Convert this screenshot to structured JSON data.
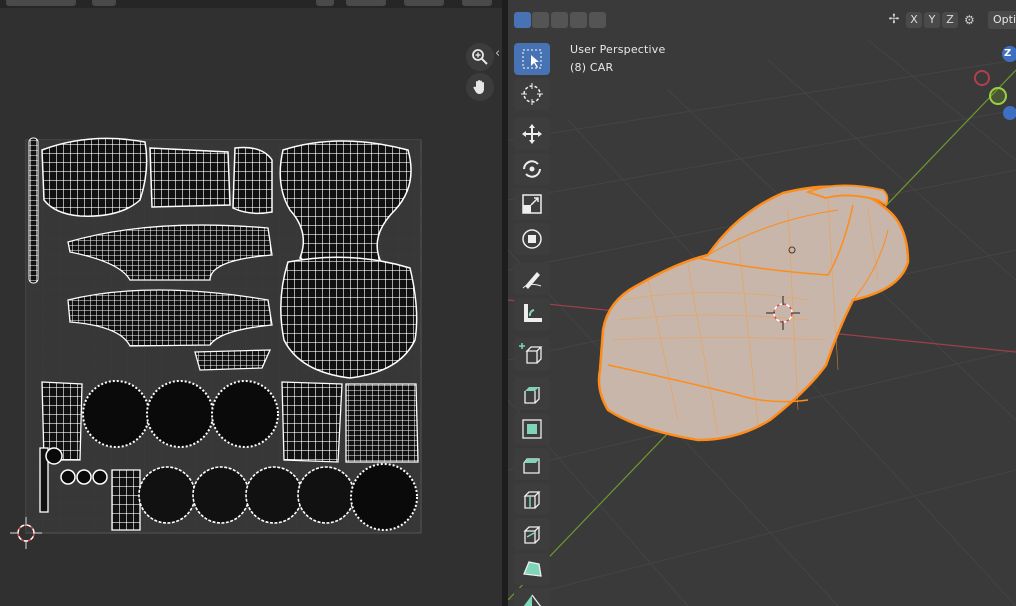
{
  "viewport": {
    "view_name": "User Perspective",
    "object_label": "(8) CAR",
    "axis_buttons": [
      "X",
      "Y",
      "Z"
    ],
    "options_label": "Opti",
    "gizmo_axis": "Z"
  },
  "uv_editor": {
    "zoom_icon": "zoom-icon",
    "pan_icon": "hand-icon",
    "collapse_glyph": "‹"
  },
  "toolbar": {
    "tools": [
      "select-box",
      "cursor",
      "move",
      "rotate",
      "scale",
      "transform",
      "annotate",
      "measure",
      "add-cube",
      "extrude",
      "inset",
      "bevel",
      "loop-cut",
      "knife",
      "poly-build",
      "spin"
    ]
  },
  "colors": {
    "accent": "#4772b3",
    "selection_orange": "#ff8c1a",
    "grid_green": "#6f9a2e",
    "grid_red": "#b0404c"
  }
}
